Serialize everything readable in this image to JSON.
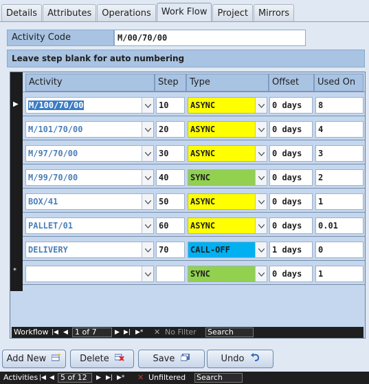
{
  "tabs": [
    "Details",
    "Attributes",
    "Operations",
    "Work Flow",
    "Project",
    "Mirrors"
  ],
  "active_tab": "Work Flow",
  "activity_code_label": "Activity Code",
  "activity_code_value": "M/00/70/00",
  "hint": "Leave step blank for auto numbering",
  "columns": {
    "activity": "Activity",
    "step": "Step",
    "type": "Type",
    "offset": "Offset",
    "used_on": "Used On"
  },
  "rows": [
    {
      "activity": "M/100/70/00",
      "step": "10",
      "type": "ASYNC",
      "offset": "0 days",
      "used_on": "8"
    },
    {
      "activity": "M/101/70/00",
      "step": "20",
      "type": "ASYNC",
      "offset": "0 days",
      "used_on": "4"
    },
    {
      "activity": "M/97/70/00",
      "step": "30",
      "type": "ASYNC",
      "offset": "0 days",
      "used_on": "3"
    },
    {
      "activity": "M/99/70/00",
      "step": "40",
      "type": "SYNC",
      "offset": "0 days",
      "used_on": "2"
    },
    {
      "activity": "BOX/41",
      "step": "50",
      "type": "ASYNC",
      "offset": "0 days",
      "used_on": "1"
    },
    {
      "activity": "PALLET/01",
      "step": "60",
      "type": "ASYNC",
      "offset": "0 days",
      "used_on": "0.01"
    },
    {
      "activity": "DELIVERY",
      "step": "70",
      "type": "CALL-OFF",
      "offset": "1 days",
      "used_on": "0"
    }
  ],
  "new_row": {
    "activity": "",
    "step": "",
    "type": "SYNC",
    "offset": "0 days",
    "used_on": "1"
  },
  "type_colors": {
    "ASYNC": "#ffff00",
    "SYNC": "#92d050",
    "CALL-OFF": "#00b0f0"
  },
  "subform_nav": {
    "label": "Workflow",
    "record": "1 of 7",
    "filter": "No Filter",
    "search": "Search"
  },
  "buttons": {
    "add": "Add New",
    "delete": "Delete",
    "save": "Save",
    "undo": "Undo"
  },
  "form_nav": {
    "label": "Activities",
    "record": "5 of 12",
    "filter": "Unfiltered",
    "search": "Search"
  }
}
